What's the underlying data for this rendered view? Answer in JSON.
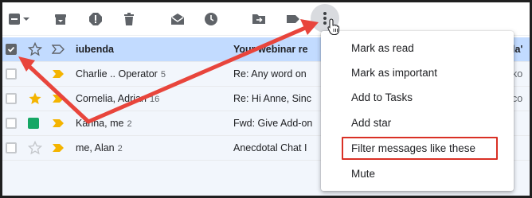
{
  "toolbar": {
    "icons": [
      "select-checkbox-icon",
      "dropdown-caret-icon",
      "archive-icon",
      "report-spam-icon",
      "delete-icon",
      "mark-read-icon",
      "snooze-icon",
      "move-to-icon",
      "label-icon",
      "more-options-icon"
    ]
  },
  "rows": [
    {
      "sender": "iubenda",
      "count": "",
      "subject": "Your webinar re",
      "edge": "la'",
      "selected": true
    },
    {
      "sender": "Charlie .. Operator",
      "count": "5",
      "subject": "Re: Any word on",
      "edge": "ko",
      "selected": false
    },
    {
      "sender": "Cornelia, Adrian",
      "count": "16",
      "subject": "Re: Hi Anne, Sinc",
      "edge": "co",
      "selected": false
    },
    {
      "sender": "Karina, me",
      "count": "2",
      "subject": "Fwd: Give Add-on",
      "edge": "",
      "selected": false
    },
    {
      "sender": "me, Alan",
      "count": "2",
      "subject": "Anecdotal Chat I",
      "edge": "",
      "selected": false
    }
  ],
  "menu": {
    "items": [
      {
        "label": "Mark as read"
      },
      {
        "label": "Mark as important"
      },
      {
        "label": "Add to Tasks"
      },
      {
        "label": "Add star"
      },
      {
        "label": "Filter messages like these"
      },
      {
        "label": "Mute"
      }
    ]
  },
  "colors": {
    "selected_row": "#c2dbff",
    "row": "#f2f6fc",
    "annotation": "#e8453c",
    "important": "#f4b400",
    "star": "#f4b400",
    "green_label": "#16a765"
  }
}
